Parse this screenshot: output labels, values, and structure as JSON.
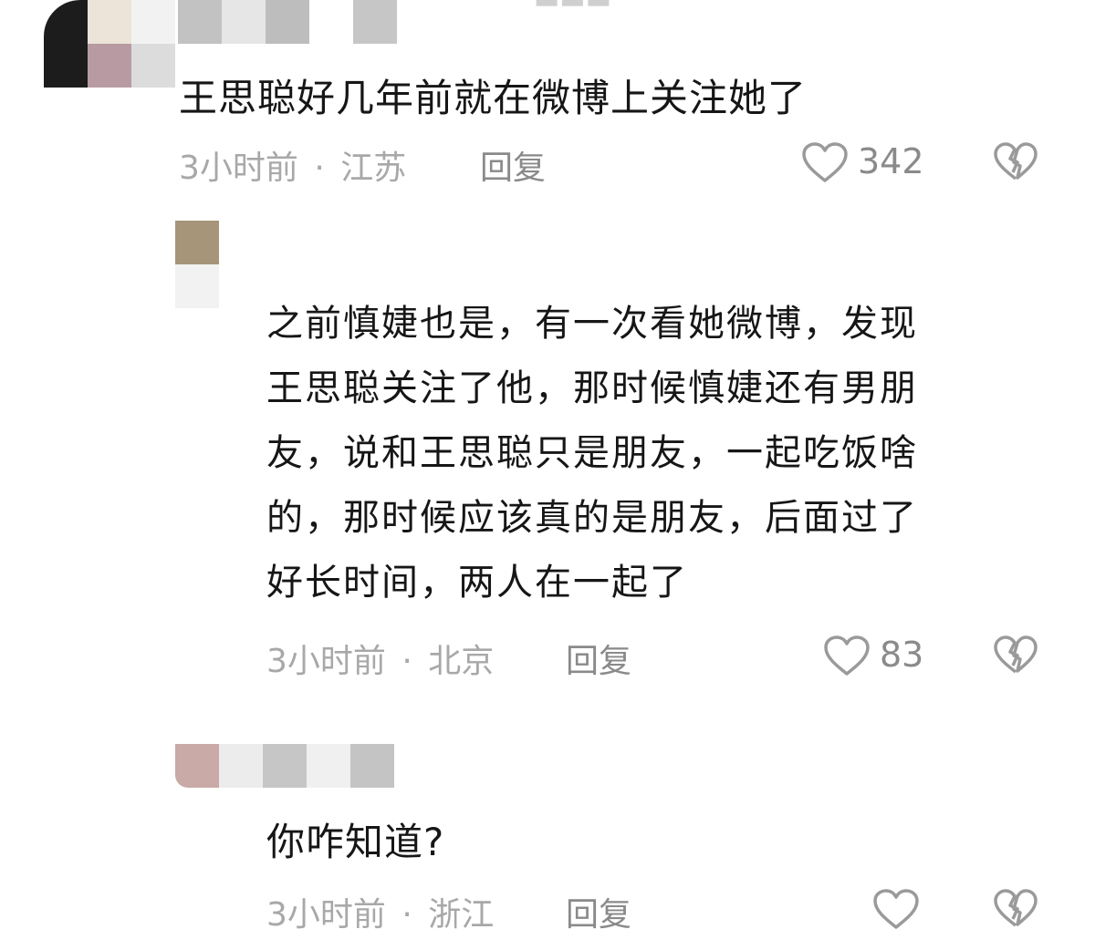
{
  "comments": [
    {
      "text": "王思聪好几年前就在微博上关注她了",
      "time": "3小时前",
      "separator": "·",
      "location": "江苏",
      "reply_label": "回复",
      "likes": "342"
    },
    {
      "text_lines": [
        "之前慎婕也是，有一次看她微博，发现",
        "王思聪关注了他，那时候慎婕还有男朋",
        "友，说和王思聪只是朋友，一起吃饭啥",
        "的，那时候应该真的是朋友，后面过了",
        "好长时间，两人在一起了"
      ],
      "time": "3小时前",
      "separator": "·",
      "location": "北京",
      "reply_label": "回复",
      "likes": "83"
    },
    {
      "text": "你咋知道?",
      "time": "3小时前",
      "separator": "·",
      "location": "浙江",
      "reply_label": "回复",
      "likes": ""
    }
  ],
  "colors": {
    "text": "#161616",
    "meta": "#a8a8a8",
    "icon": "#9a9a9a"
  },
  "icons": [
    "heart-icon",
    "broken-heart-icon"
  ]
}
